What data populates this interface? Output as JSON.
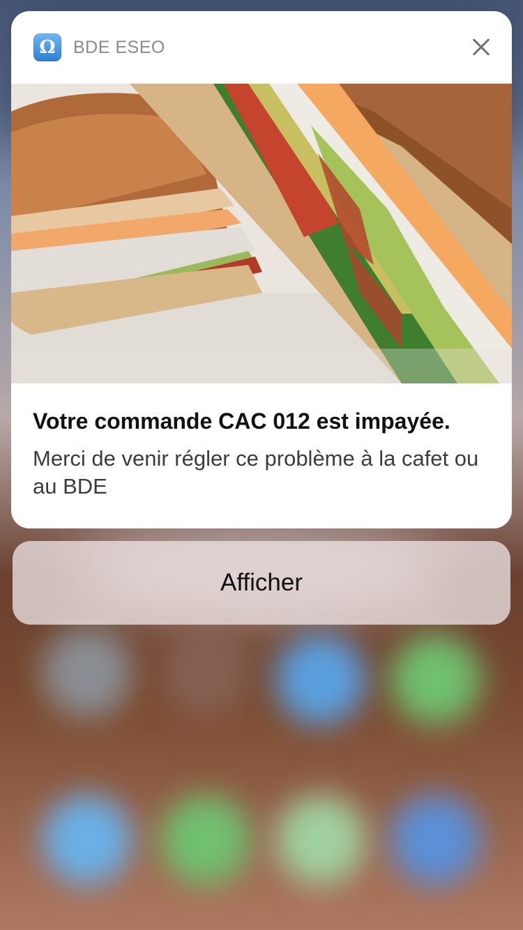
{
  "notification": {
    "app_name": "BDE ESEO",
    "app_icon": "bde-eseo-app-icon",
    "close_icon": "close-icon",
    "image": "sandwich-photo",
    "title": "Votre commande CAC 012 est impayée.",
    "body": "Merci de venir régler ce problème à la cafet ou au BDE"
  },
  "actions": {
    "view_label": "Afficher"
  },
  "colors": {
    "card_background": "#ffffff",
    "app_name": "#8a8a8e",
    "title": "#111111",
    "body": "#3c3c40",
    "action_background": "#ece2e2"
  }
}
